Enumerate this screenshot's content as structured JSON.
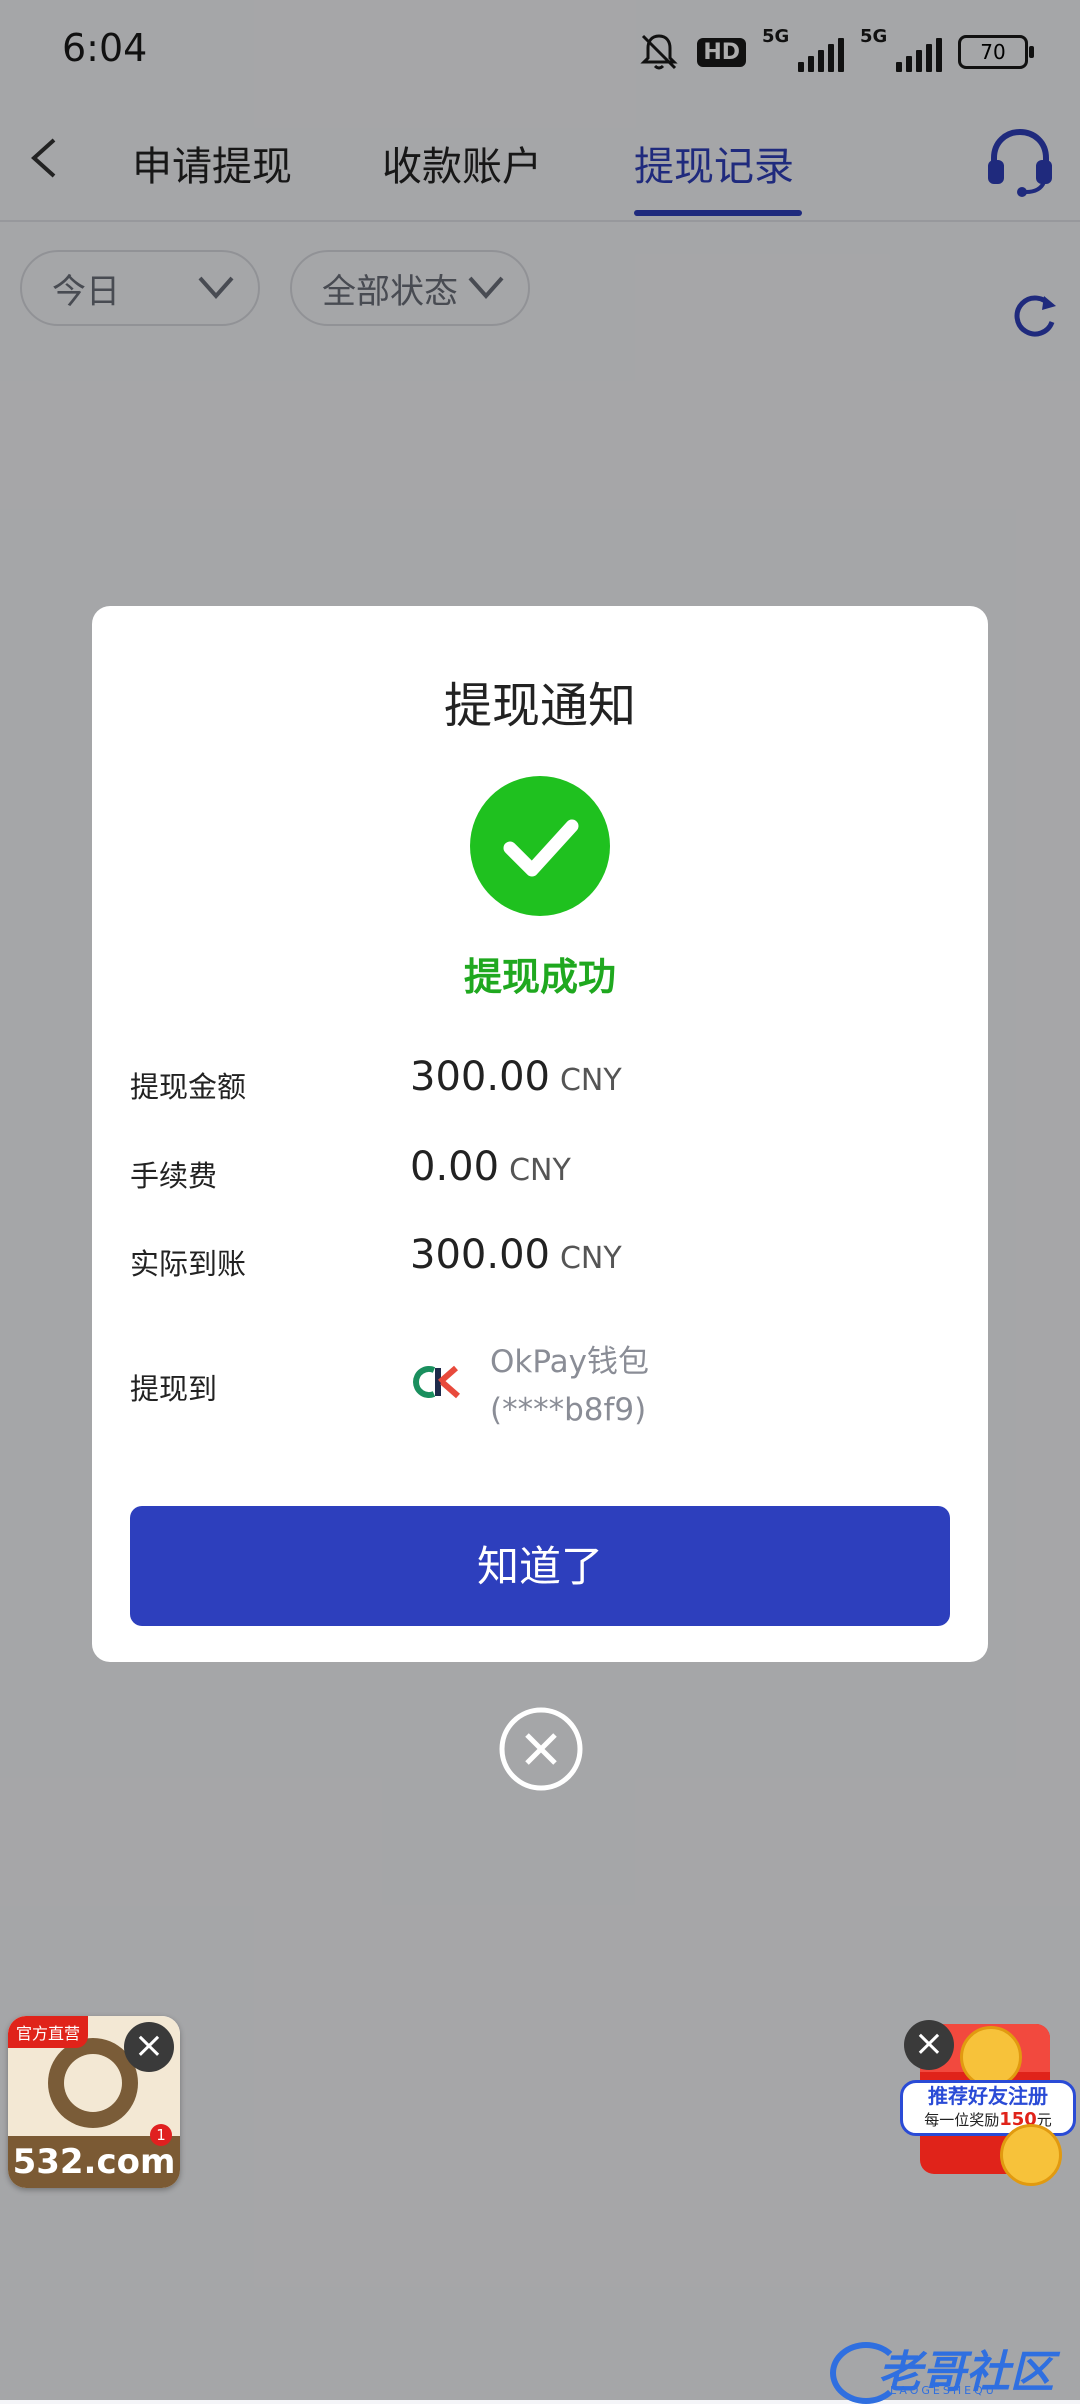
{
  "status_bar": {
    "time": "6:04",
    "hd_label": "HD",
    "network_1": "5G",
    "network_2": "5G",
    "battery": "70"
  },
  "nav": {
    "tabs": [
      {
        "label": "申请提现"
      },
      {
        "label": "收款账户"
      },
      {
        "label": "提现记录"
      }
    ],
    "active_tab": "提现记录",
    "accent": "#2e3fb8"
  },
  "filters": {
    "date": "今日",
    "status": "全部状态"
  },
  "dialog": {
    "title": "提现通知",
    "result": "提现成功",
    "rows": [
      {
        "label": "提现金额",
        "value": "300.00",
        "unit": "CNY"
      },
      {
        "label": "手续费",
        "value": "0.00",
        "unit": "CNY"
      },
      {
        "label": "实际到账",
        "value": "300.00",
        "unit": "CNY"
      }
    ],
    "destination": {
      "label": "提现到",
      "wallet": "OkPay钱包",
      "account": "(****b8f9)"
    },
    "confirm_button": "知道了",
    "success_color": "#1fc11f",
    "button_color": "#2d3fbd"
  },
  "ads": {
    "left": {
      "tag": "官方直营",
      "domain": "532.com",
      "badge": "1"
    },
    "right": {
      "line1": "推荐好友注册",
      "line2_prefix": "每一位奖励",
      "line2_amount": "150",
      "line2_suffix": "元"
    }
  },
  "watermark": {
    "text": "老哥社区",
    "subtext": "LAOGESHEQU"
  }
}
